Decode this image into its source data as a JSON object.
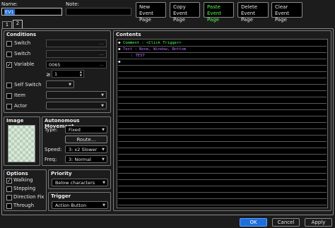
{
  "header": {
    "name_label": "Name:",
    "name_value": "EV1",
    "note_label": "Note:",
    "note_value": "",
    "buttons": [
      {
        "label": "New\nEvent Page",
        "active": false
      },
      {
        "label": "Copy\nEvent Page",
        "active": false
      },
      {
        "label": "Paste\nEvent Page",
        "active": true
      },
      {
        "label": "Delete\nEvent Page",
        "active": false
      },
      {
        "label": "Clear\nEvent Page",
        "active": false
      }
    ]
  },
  "tabs": [
    "1",
    "2"
  ],
  "conditions": {
    "title": "Conditions",
    "switch1": {
      "label": "Switch",
      "checked": false,
      "value": ""
    },
    "switch2": {
      "label": "Switch",
      "checked": false,
      "value": ""
    },
    "variable": {
      "label": "Variable",
      "checked": true,
      "value": "0065",
      "op": "≥",
      "number": "1"
    },
    "self_switch": {
      "label": "Self Switch",
      "checked": false,
      "value": ""
    },
    "item": {
      "label": "Item",
      "checked": false,
      "value": ""
    },
    "actor": {
      "label": "Actor",
      "checked": false,
      "value": ""
    }
  },
  "image": {
    "title": "Image"
  },
  "autonomous": {
    "title": "Autonomous Movement",
    "type_label": "Type:",
    "type_value": "Fixed",
    "route_label": "Route...",
    "speed_label": "Speed:",
    "speed_value": "3: x2 Slower",
    "freq_label": "Freq:",
    "freq_value": "3: Normal"
  },
  "options": {
    "title": "Options",
    "items": [
      {
        "label": "Walking",
        "checked": true
      },
      {
        "label": "Stepping",
        "checked": false
      },
      {
        "label": "Direction Fix",
        "checked": false
      },
      {
        "label": "Through",
        "checked": false
      }
    ]
  },
  "priority": {
    "title": "Priority",
    "value": "Below characters"
  },
  "trigger": {
    "title": "Trigger",
    "value": "Action Button"
  },
  "contents": {
    "title": "Contents",
    "rows": [
      {
        "prefix": "◆",
        "text": "Comment : <Click Trigger>",
        "color": "#55ff55"
      },
      {
        "prefix": "◆",
        "text": "Text : None, Window, Bottom",
        "color": "#c070ff"
      },
      {
        "prefix": "",
        "text": ": TEST",
        "color": "#c070ff"
      },
      {
        "prefix": "◆",
        "text": "",
        "color": "#ffffff"
      }
    ]
  },
  "footer": {
    "ok": "OK",
    "cancel": "Cancel",
    "apply": "Apply"
  },
  "colors": {
    "accent": "#1e6fd9",
    "green_text": "#55ff55",
    "purple_text": "#c070ff"
  }
}
